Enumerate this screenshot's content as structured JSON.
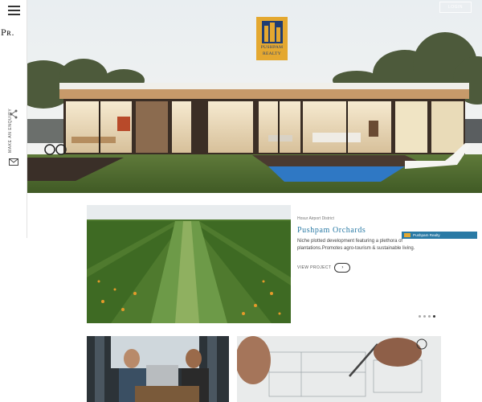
{
  "brand": {
    "side_mark": "Pʀ.",
    "logo_line1": "PUSHPAM",
    "logo_line2": "REALTY"
  },
  "header": {
    "login_label": "LOGIN"
  },
  "rail": {
    "menu_icon": "hamburger-icon",
    "share_icon": "share-icon",
    "enquiry_label": "MAKE AN ENQUIRY",
    "mail_icon": "mail-icon"
  },
  "project": {
    "district": "Hosur Airport District",
    "title": "Pushpam Orchards",
    "description": "Niche plotted development featuring a plethora of plantations.Promotes agro-tourism & sustainable living.",
    "view_label": "VIEW PROJECT",
    "view_icon": "chevron-right-icon",
    "badge_label": "Pushpam Realty",
    "slides_total": 4,
    "slide_active": 4
  },
  "colors": {
    "brand_gold": "#e4a830",
    "brand_navy": "#1f3d73",
    "accent_blue": "#2a7aa5"
  }
}
